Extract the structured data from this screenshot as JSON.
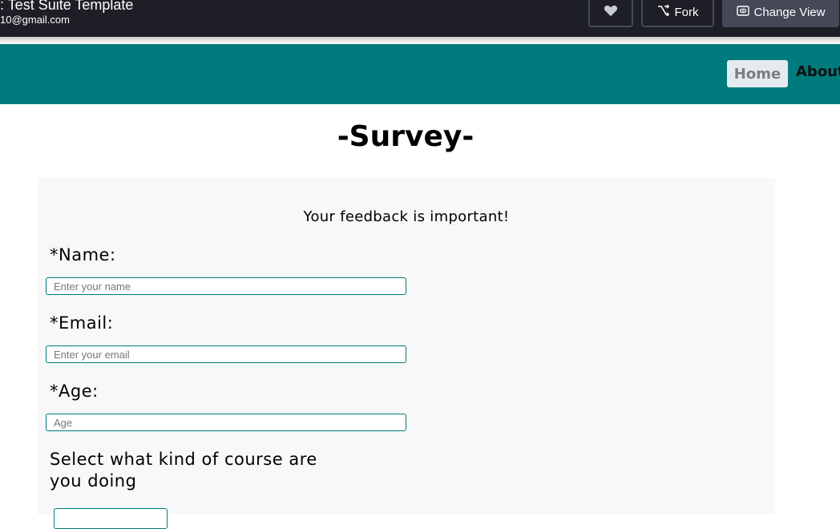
{
  "topbar": {
    "title": ": Test Suite Template",
    "user": "10@gmail.com",
    "like_icon": "heart-icon",
    "fork_label": "Fork",
    "fork_icon": "fork-icon",
    "view_label": "Change View",
    "view_icon": "eye-icon"
  },
  "nav": {
    "background": "#007b7d",
    "home_label": "Home",
    "about_label": "About"
  },
  "page": {
    "title": "-Survey-",
    "feedback": "Your feedback is important!"
  },
  "form": {
    "name_label": "*Name:",
    "name_placeholder": "Enter your name",
    "email_label": "*Email:",
    "email_placeholder": "Enter your email",
    "age_label": "*Age:",
    "age_placeholder": "Age",
    "course_label": "Select what kind of course are you doing"
  }
}
